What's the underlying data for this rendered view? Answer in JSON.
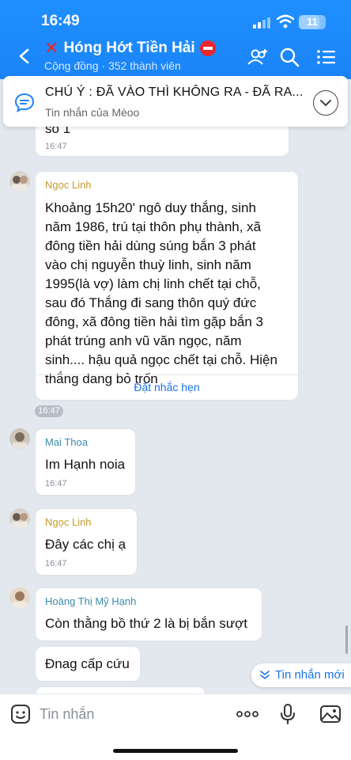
{
  "status_bar": {
    "time": "16:49",
    "battery": "11"
  },
  "header": {
    "group_name": "Hóng Hớt Tiền Hải",
    "subtitle": "Cộng đồng · 352 thành viên"
  },
  "pinned": {
    "title": "CHÚ Ý : ĐÃ VÀO THÌ KHÔNG RA - ĐÃ RA...",
    "subtitle": "Tin nhắn của Mèoo"
  },
  "messages": [
    {
      "partial_text": "số 1",
      "time": "16:47"
    },
    {
      "sender": "Ngọc Linh",
      "lines": [
        "Khoảng 15h20' ngô duy thắng, sinh",
        "năm 1986, trú tại thôn phụ thành, xã",
        "đông tiền hải dùng súng bắn 3 phát",
        "vào chị nguyễn thuỳ linh, sinh năm",
        "1995(là vợ) làm chị linh chết tại chỗ,",
        "sau đó Thắng đi sang thôn quý đức",
        "đông, xã đông tiền hải tìm gặp bắn 3",
        "phát trúng anh vũ văn ngọc, năm",
        "sinh.... hậu quả ngọc chết tại chỗ. Hiện",
        "thắng đang bỏ trốn"
      ],
      "action": "Đặt nhắc hẹn",
      "time": "16:47"
    },
    {
      "sender": "Mai Thoa",
      "text": "Im Hạnh noia",
      "time": "16:47"
    },
    {
      "sender": "Ngọc Linh",
      "text": "Đây các chị ạ",
      "time": "16:47"
    },
    {
      "sender": "Hoàng Thị Mỹ Hạnh",
      "text": "Còn thằng bồ thứ 2 là bị bắn sượt"
    },
    {
      "text": "Đnag cấp cứu"
    }
  ],
  "new_messages_label": "Tin nhắn mới",
  "composer": {
    "placeholder": "Tin nhắn"
  },
  "colors": {
    "header": "#1a84f7",
    "sender_gold": "#c79a2c",
    "sender_teal": "#3a8aa8",
    "link": "#1a73e8"
  }
}
